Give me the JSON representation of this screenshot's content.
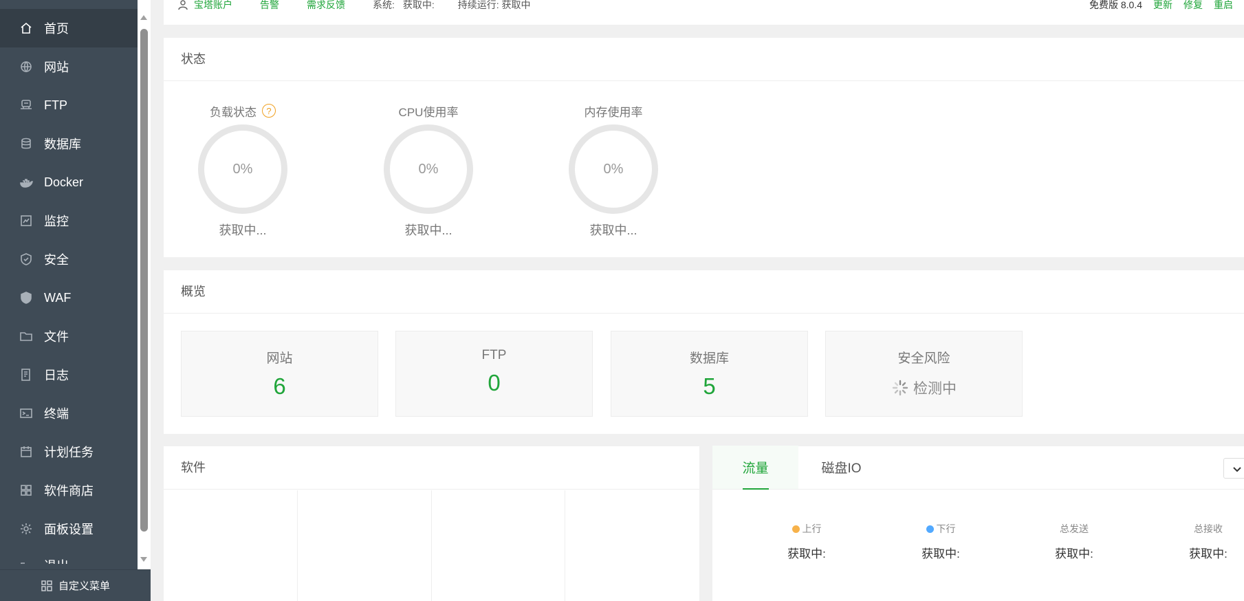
{
  "sidebar": {
    "items": [
      {
        "label": "首页",
        "icon": "home-icon",
        "active": true
      },
      {
        "label": "网站",
        "icon": "globe-icon"
      },
      {
        "label": "FTP",
        "icon": "ftp-icon"
      },
      {
        "label": "数据库",
        "icon": "database-icon"
      },
      {
        "label": "Docker",
        "icon": "docker-icon"
      },
      {
        "label": "监控",
        "icon": "monitor-icon"
      },
      {
        "label": "安全",
        "icon": "shield-check-icon"
      },
      {
        "label": "WAF",
        "icon": "waf-shield-icon"
      },
      {
        "label": "文件",
        "icon": "folder-icon"
      },
      {
        "label": "日志",
        "icon": "log-icon"
      },
      {
        "label": "终端",
        "icon": "terminal-icon"
      },
      {
        "label": "计划任务",
        "icon": "calendar-icon"
      },
      {
        "label": "软件商店",
        "icon": "grid-icon"
      },
      {
        "label": "面板设置",
        "icon": "gear-icon"
      },
      {
        "label": "退出",
        "icon": "logout-icon"
      }
    ],
    "custom_menu": "自定义菜单"
  },
  "topbar": {
    "account": "宝塔账户",
    "alarm": "告警",
    "feedback": "需求反馈",
    "system_label": "系统:",
    "system_value": "获取中:",
    "uptime": "持续运行: 获取中",
    "version": "免费版 8.0.4",
    "update": "更新",
    "repair": "修复",
    "restart": "重启"
  },
  "status": {
    "title": "状态",
    "gauges": [
      {
        "label": "负载状态",
        "value": "0%",
        "sub": "获取中..."
      },
      {
        "label": "CPU使用率",
        "value": "0%",
        "sub": "获取中..."
      },
      {
        "label": "内存使用率",
        "value": "0%",
        "sub": "获取中..."
      }
    ],
    "help": "?"
  },
  "overview": {
    "title": "概览",
    "cards": [
      {
        "label": "网站",
        "value": "6"
      },
      {
        "label": "FTP",
        "value": "0"
      },
      {
        "label": "数据库",
        "value": "5"
      },
      {
        "label": "安全风险",
        "value": "检测中"
      }
    ]
  },
  "software": {
    "title": "软件"
  },
  "traffic": {
    "tabs": [
      "流量",
      "磁盘IO"
    ],
    "stats": [
      {
        "label": "上行",
        "value": "获取中:",
        "color": "#f7b24a"
      },
      {
        "label": "下行",
        "value": "获取中:",
        "color": "#52a9ff"
      },
      {
        "label": "总发送",
        "value": "获取中:"
      },
      {
        "label": "总接收",
        "value": "获取中:"
      }
    ]
  },
  "colors": {
    "accent": "#20a53a",
    "sidebar": "#3f4b56"
  }
}
